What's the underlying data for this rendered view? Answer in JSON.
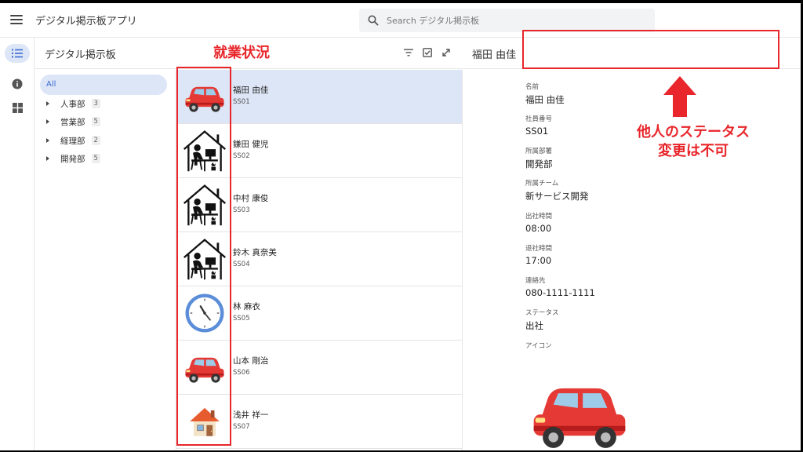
{
  "app": {
    "title": "デジタル掲示板アプリ"
  },
  "search": {
    "placeholder": "Search デジタル掲示板"
  },
  "rail": {
    "icons": [
      "list-icon",
      "info-icon",
      "grid-icon"
    ]
  },
  "tree": {
    "title": "デジタル掲示板",
    "all_label": "All",
    "items": [
      {
        "label": "人事部",
        "count": "3"
      },
      {
        "label": "営業部",
        "count": "5"
      },
      {
        "label": "経理部",
        "count": "2"
      },
      {
        "label": "開発部",
        "count": "5"
      }
    ]
  },
  "list": {
    "rows": [
      {
        "name": "福田 由佳",
        "code": "SS01",
        "icon": "car-icon"
      },
      {
        "name": "鎌田 健児",
        "code": "SS02",
        "icon": "work-from-home-icon"
      },
      {
        "name": "中村 康俊",
        "code": "SS03",
        "icon": "work-from-home-icon"
      },
      {
        "name": "鈴木 真奈美",
        "code": "SS04",
        "icon": "work-from-home-icon"
      },
      {
        "name": "林 麻衣",
        "code": "SS05",
        "icon": "clock-icon"
      },
      {
        "name": "山本 剛治",
        "code": "SS06",
        "icon": "car-icon"
      },
      {
        "name": "浅井 祥一",
        "code": "SS07",
        "icon": "house-icon"
      }
    ]
  },
  "detail": {
    "header_name": "福田 由佳",
    "fields": [
      {
        "label": "名前",
        "value": "福田 由佳"
      },
      {
        "label": "社員番号",
        "value": "SS01"
      },
      {
        "label": "所属部署",
        "value": "開発部"
      },
      {
        "label": "所属チーム",
        "value": "新サービス開発"
      },
      {
        "label": "出社時間",
        "value": "08:00"
      },
      {
        "label": "退社時間",
        "value": "17:00"
      },
      {
        "label": "連絡先",
        "value": "080-1111-1111"
      },
      {
        "label": "ステータス",
        "value": "出社"
      }
    ],
    "icon_label": "アイコン",
    "icon": "car-icon"
  },
  "annotations": {
    "status_column": "就業状況",
    "note_line1": "他人のステータス",
    "note_line2": "変更は不可",
    "color": "#e8262b"
  },
  "colors": {
    "selected": "#dde6f7",
    "accent": "#3d6bd1"
  }
}
